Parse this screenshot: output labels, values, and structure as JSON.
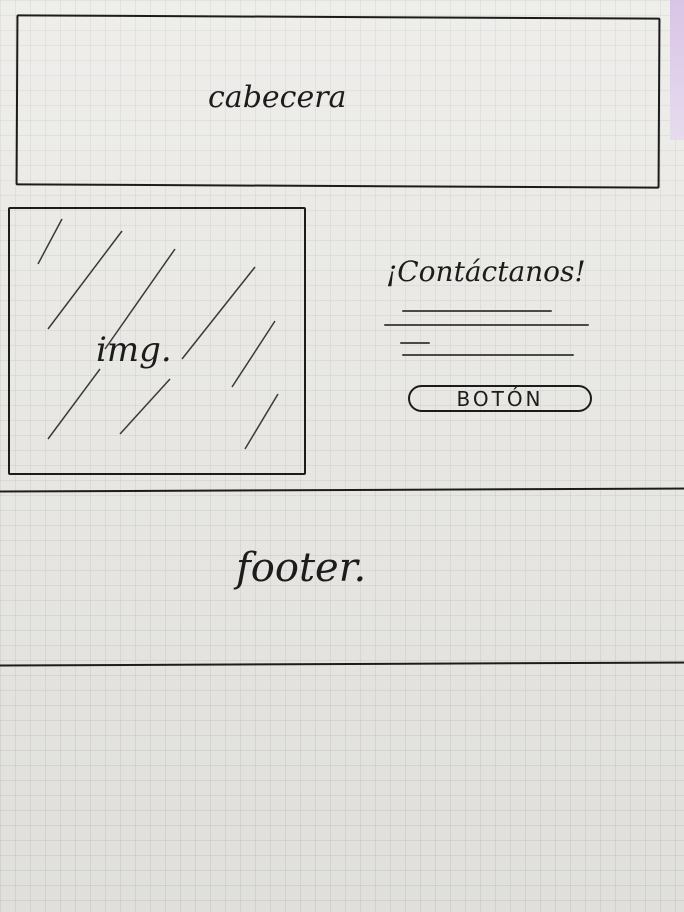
{
  "header": {
    "label": "cabecera"
  },
  "hero": {
    "image_label": "img.",
    "contact_title": "¡Contáctanos!",
    "button_label": "BOTÓN"
  },
  "footer": {
    "label": "footer."
  },
  "colors": {
    "ink": "#1c1c1c",
    "paper": "#e9e8e4",
    "accent": "#d9c4e6"
  }
}
